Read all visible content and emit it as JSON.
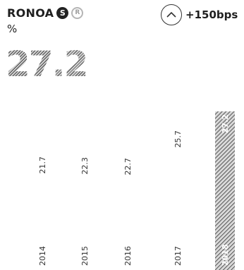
{
  "header": {
    "title": "RONOA",
    "badge_s": "S",
    "badge_r": "R",
    "unit": "%",
    "change": "+150bps",
    "change_icon": "chevron-up-icon",
    "big_value": "27.2"
  },
  "chart_data": {
    "type": "bar",
    "title": "",
    "xlabel": "",
    "ylabel": "",
    "categories": [
      "2014",
      "2015",
      "2016",
      "2017",
      "2018"
    ],
    "values": [
      21.7,
      22.3,
      22.7,
      25.7,
      27.2
    ],
    "labels": [
      "21.7",
      "22.3",
      "22.7",
      "25.7",
      "27.2"
    ],
    "highlight_index": 4,
    "ylim": [
      0,
      27.2
    ],
    "grid": false,
    "colors": {
      "highlight": "#7a7a7a",
      "text": "#333333"
    }
  }
}
